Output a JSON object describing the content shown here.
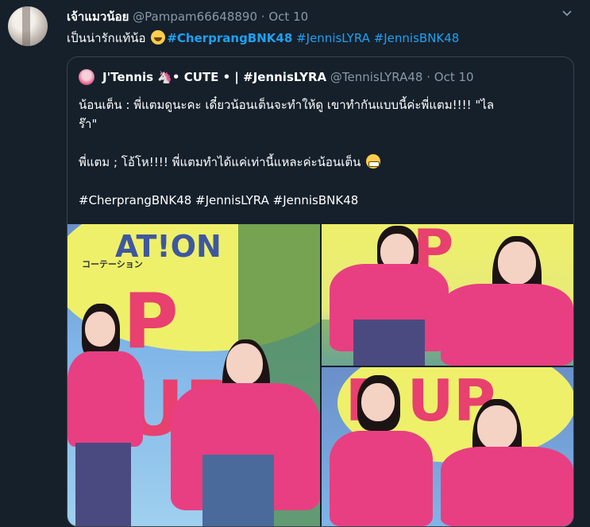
{
  "tweet": {
    "display_name": "เจ้าแมวน้อย",
    "handle": "@Pampam66648890",
    "separator": "·",
    "date": "Oct 10",
    "text_prefix": "เป็นน่ารักแท้น้อ ",
    "hashtags": [
      "#CherprangBNK48",
      "#JennisLYRA",
      "#JennisBNK48"
    ],
    "emoji": "rolling-on-floor-laughing"
  },
  "quote": {
    "display_name": "J'Tennis 🦄• CUTE • | #JennisLYRA",
    "handle": "@TennisLYRA48",
    "separator": "·",
    "date": "Oct 10",
    "lines": [
      "น้อนเต็น : พี่แตมดูนะคะ เดี๋ยวน้อนเต็นจะทำให้ดู เขาทำกันแบบนี้ค่ะพี่แตม!!!! \"ไล",
      "ร๊า\""
    ],
    "line2": "พี่แตม ; โอ้โห!!!! พี่แตมทำได้แค่เท่านี้แหละค่ะน้อนเต็น",
    "hashtag_line": "#CherprangBNK48 #JennisLYRA #JennisBNK48",
    "photos": [
      {
        "sign_text": "AT!ON",
        "sign_sub": "コーテーション",
        "sign_big": "P UP"
      },
      {
        "sign_text": "P",
        "sign_sub": "",
        "sign_big": ""
      },
      {
        "sign_text": "P UP",
        "sign_sub": "",
        "sign_big": ""
      }
    ]
  },
  "colors": {
    "background": "#15202b",
    "link": "#1da1f2",
    "muted": "#8899a6",
    "border": "#38444d",
    "jacket": "#e83f82",
    "sign_yellow": "#eef06a",
    "sign_blue": "#7fb5e8"
  },
  "icons": {
    "menu": "chevron-down-icon",
    "tweet_emoji": "rofl-emoji-icon",
    "quote_emoji": "grimacing-face-emoji-icon"
  }
}
